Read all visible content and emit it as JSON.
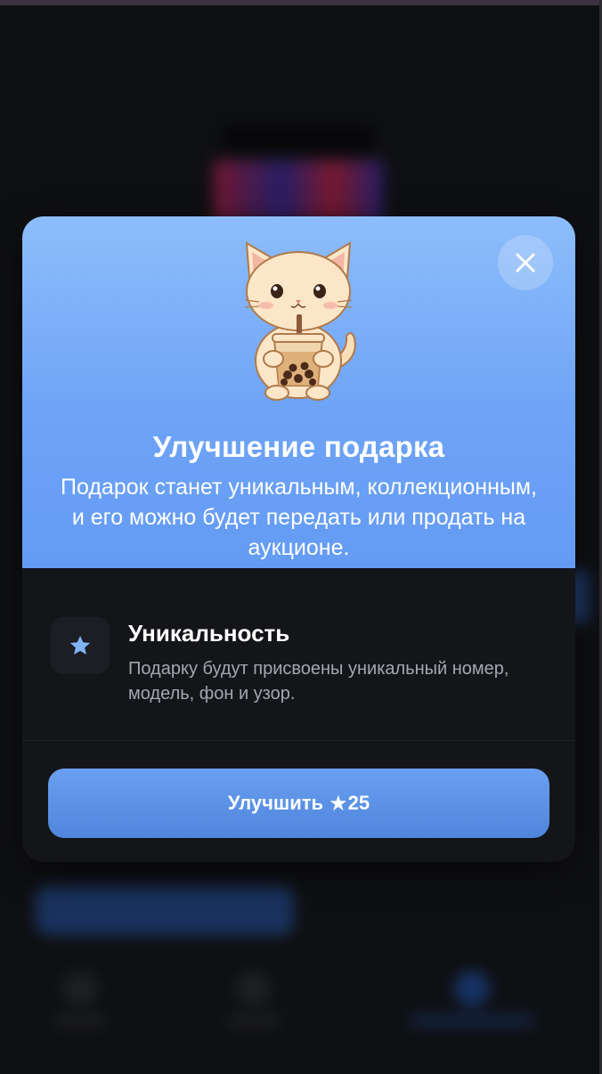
{
  "modal": {
    "title": "Улучшение подарка",
    "description": "Подарок станет уникальным, коллекционным, и его можно будет передать или продать на аукционе.",
    "close_icon": "close-icon",
    "sticker": "cat-boba-tea-sticker",
    "feature": {
      "icon": "star-icon",
      "title": "Уникальность",
      "description": "Подарку будут присвоены уникальный номер, модель, фон и узор."
    },
    "upgrade_button": {
      "label": "Улучшить",
      "star_glyph": "★",
      "price": "25"
    }
  },
  "colors": {
    "hero_top": "#8dbdfb",
    "hero_bottom": "#649bf4",
    "modal_bg": "#141519",
    "button": "#5b91e6",
    "page_bg": "#0f1013"
  }
}
